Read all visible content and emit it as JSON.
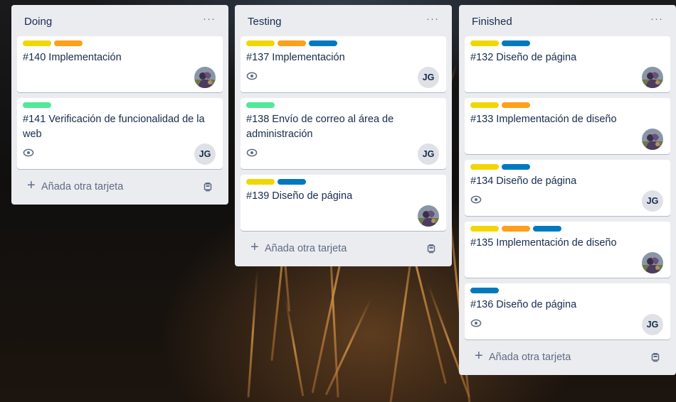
{
  "colors": {
    "yellow": "#f2d600",
    "orange": "#ff9f1a",
    "blue": "#0079bf",
    "green": "#61bd4f",
    "mint": "#51e898"
  },
  "icons": {
    "list_menu": "ellipsis-icon",
    "watch": "eye-icon",
    "add": "plus-icon",
    "template": "card-template-icon"
  },
  "lists": [
    {
      "title": "Doing",
      "menu": "···",
      "add_card": "Añada otra tarjeta",
      "add_plus": "+",
      "cards": [
        {
          "labels": [
            "yellow",
            "orange"
          ],
          "title": "#140 Implementación",
          "watch": false,
          "avatar": "photo"
        },
        {
          "labels": [
            "mint"
          ],
          "title": "#141 Verificación de funcionalidad de la web",
          "watch": true,
          "avatar": "JG"
        }
      ]
    },
    {
      "title": "Testing",
      "menu": "···",
      "add_card": "Añada otra tarjeta",
      "add_plus": "+",
      "cards": [
        {
          "labels": [
            "yellow",
            "orange",
            "blue"
          ],
          "title": "#137 Implementación",
          "watch": true,
          "avatar": "JG"
        },
        {
          "labels": [
            "mint"
          ],
          "title": "#138 Envío de correo al área de administración",
          "watch": true,
          "avatar": "JG"
        },
        {
          "labels": [
            "yellow",
            "blue"
          ],
          "title": "#139 Diseño de página",
          "watch": false,
          "avatar": "photo"
        }
      ]
    },
    {
      "title": "Finished",
      "menu": "···",
      "add_card": "Añada otra tarjeta",
      "add_plus": "+",
      "cards": [
        {
          "labels": [
            "yellow",
            "blue"
          ],
          "title": "#132 Diseño de página",
          "watch": false,
          "avatar": "photo"
        },
        {
          "labels": [
            "yellow",
            "orange"
          ],
          "title": "#133 Implementación de diseño",
          "watch": false,
          "avatar": "photo"
        },
        {
          "labels": [
            "yellow",
            "blue"
          ],
          "title": "#134 Diseño de página",
          "watch": true,
          "avatar": "JG"
        },
        {
          "labels": [
            "yellow",
            "orange",
            "blue"
          ],
          "title": "#135 Implementación de diseño",
          "watch": false,
          "avatar": "photo"
        },
        {
          "labels": [
            "blue"
          ],
          "title": "#136 Diseño de página",
          "watch": true,
          "avatar": "JG"
        }
      ]
    }
  ]
}
